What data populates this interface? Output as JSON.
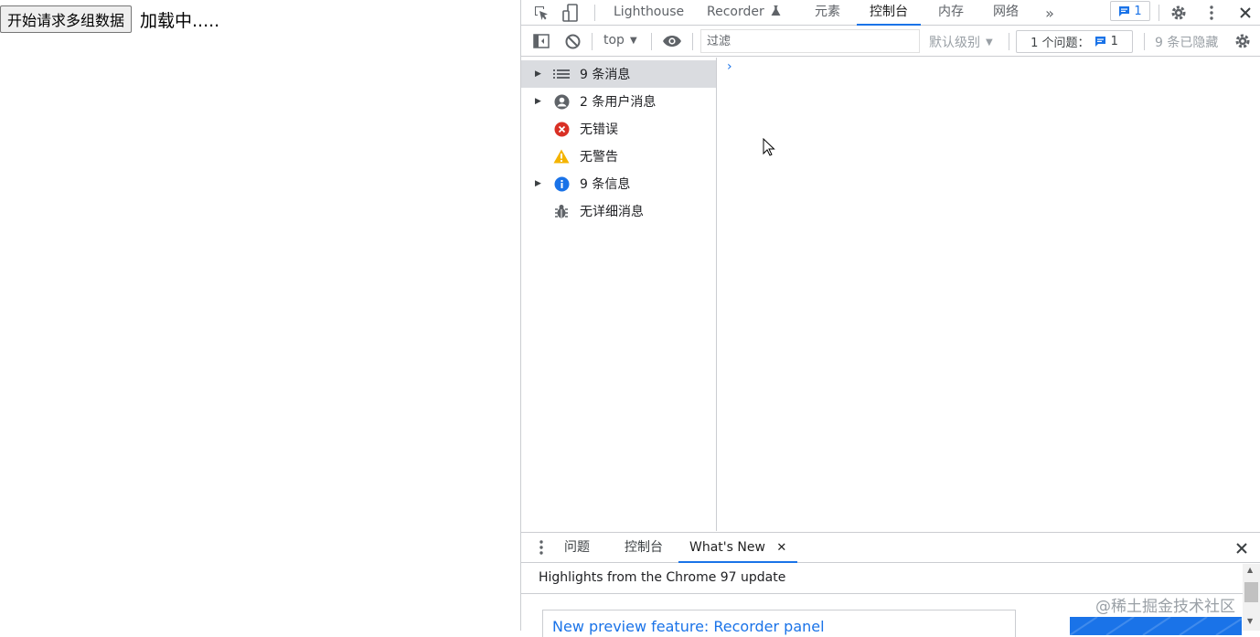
{
  "page": {
    "button_label": "开始请求多组数据",
    "loading_text": "加载中....."
  },
  "devtools": {
    "tabs": [
      {
        "label": "Lighthouse"
      },
      {
        "label": "Recorder"
      },
      {
        "label": "元素"
      },
      {
        "label": "控制台"
      },
      {
        "label": "内存"
      },
      {
        "label": "网络"
      }
    ],
    "issues_count": "1",
    "toolbar": {
      "context": "top",
      "filter_placeholder": "过滤",
      "level": "默认级别",
      "issues_label": "1 个问题：",
      "issues_count": "1",
      "hidden": "9 条已隐藏"
    },
    "sidebar": [
      {
        "label": "9 条消息",
        "icon": "list-icon"
      },
      {
        "label": "2 条用户消息",
        "icon": "user-icon"
      },
      {
        "label": "无错误",
        "icon": "error-icon"
      },
      {
        "label": "无警告",
        "icon": "warning-icon"
      },
      {
        "label": "9 条信息",
        "icon": "info-icon"
      },
      {
        "label": "无详细消息",
        "icon": "bug-icon"
      }
    ],
    "drawer": {
      "tabs": [
        {
          "label": "问题"
        },
        {
          "label": "控制台"
        },
        {
          "label": "What's New"
        }
      ],
      "heading": "Highlights from the Chrome 97 update",
      "link": "New preview feature: Recorder panel"
    },
    "watermark": "@稀土掘金技术社区"
  },
  "colors": {
    "accent": "#1a73e8",
    "error": "#d93025",
    "warning": "#f4b400",
    "info": "#1a73e8"
  }
}
